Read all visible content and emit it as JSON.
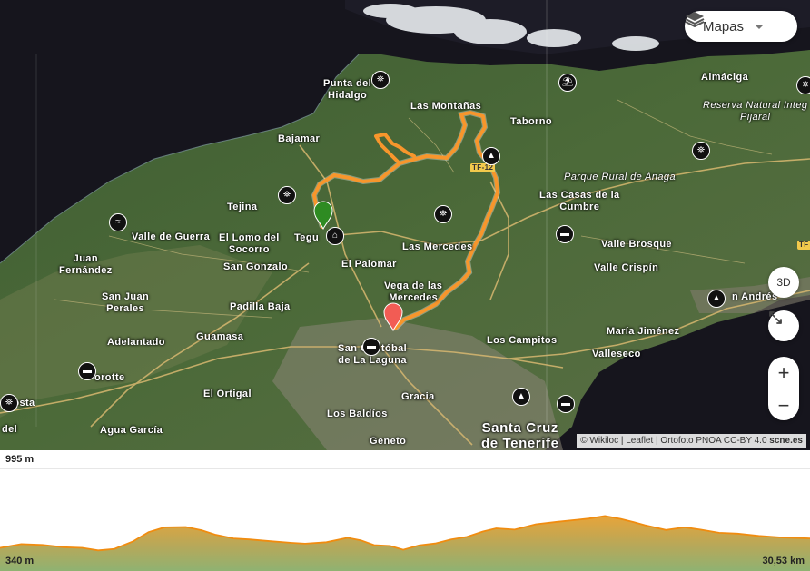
{
  "map": {
    "place_labels": [
      {
        "id": "punta-del-hidalgo",
        "text": "Punta del\nHidalgo"
      },
      {
        "id": "las-montanas",
        "text": "Las Montañas"
      },
      {
        "id": "taborno",
        "text": "Taborno"
      },
      {
        "id": "almaciga",
        "text": "Almáciga"
      },
      {
        "id": "reserva",
        "text": "Reserva Natural Integ\nPijaral"
      },
      {
        "id": "bajamar",
        "text": "Bajamar"
      },
      {
        "id": "parque-rural",
        "text": "Parque Rural de Anaga"
      },
      {
        "id": "las-casas",
        "text": "Las Casas de la\nCumbre"
      },
      {
        "id": "tejina",
        "text": "Tejina"
      },
      {
        "id": "valle-guerra",
        "text": "Valle de Guerra"
      },
      {
        "id": "lomo-socorro",
        "text": "El Lomo del\nSocorro"
      },
      {
        "id": "tegueste",
        "text": "Tegu"
      },
      {
        "id": "las-mercedes",
        "text": "Las Mercedes"
      },
      {
        "id": "valle-brosque",
        "text": "Valle Brosque"
      },
      {
        "id": "juan-fernandez",
        "text": "Juan\nFernández"
      },
      {
        "id": "san-gonzalo",
        "text": "San Gonzalo"
      },
      {
        "id": "el-palomar",
        "text": "El Palomar"
      },
      {
        "id": "valle-crispin",
        "text": "Valle Crispín"
      },
      {
        "id": "vega-mercedes",
        "text": "Vega de las\nMercedes"
      },
      {
        "id": "san-juan-perales",
        "text": "San Juan\nPerales"
      },
      {
        "id": "padilla-baja",
        "text": "Padilla Baja"
      },
      {
        "id": "san-andres",
        "text": "n Andrés"
      },
      {
        "id": "guamasa",
        "text": "Guamasa"
      },
      {
        "id": "maria-jimenez",
        "text": "María Jiménez"
      },
      {
        "id": "adelantado",
        "text": "Adelantado"
      },
      {
        "id": "san-cristobal",
        "text": "San Cristóbal\nde La Laguna"
      },
      {
        "id": "los-campitos",
        "text": "Los Campitos"
      },
      {
        "id": "valleseco",
        "text": "Valleseco"
      },
      {
        "id": "orotte",
        "text": "orotte"
      },
      {
        "id": "costa",
        "text": "Costa"
      },
      {
        "id": "el-ortigal",
        "text": "El Ortigal"
      },
      {
        "id": "gracia",
        "text": "Gracia"
      },
      {
        "id": "del",
        "text": "del"
      },
      {
        "id": "los-baldios",
        "text": "Los Baldíos"
      },
      {
        "id": "agua-garcia",
        "text": "Agua García"
      },
      {
        "id": "geneto",
        "text": "Geneto"
      },
      {
        "id": "santa-cruz",
        "text": "Santa Cruz\nde Tenerife"
      }
    ],
    "road_labels": [
      "TF-12",
      "TF"
    ],
    "poi_icons": [
      {
        "id": "poi-1",
        "icon": "binoculars-icon",
        "glyph": "⛯"
      },
      {
        "id": "poi-2",
        "icon": "beach-icon",
        "glyph": "⛱"
      },
      {
        "id": "poi-3",
        "icon": "binoculars-icon",
        "glyph": "⛯"
      },
      {
        "id": "poi-4",
        "icon": "mountain-icon",
        "glyph": "▲"
      },
      {
        "id": "poi-5",
        "icon": "binoculars-icon",
        "glyph": "⛯"
      },
      {
        "id": "poi-6",
        "icon": "binoculars-icon",
        "glyph": "⛯"
      },
      {
        "id": "poi-7",
        "icon": "swimming-icon",
        "glyph": "≈"
      },
      {
        "id": "poi-8",
        "icon": "binoculars-icon",
        "glyph": "⛯"
      },
      {
        "id": "poi-9",
        "icon": "museum-icon",
        "glyph": "⌂"
      },
      {
        "id": "poi-10",
        "icon": "bed-icon",
        "glyph": "▬"
      },
      {
        "id": "poi-11",
        "icon": "tent-icon",
        "glyph": "▲"
      },
      {
        "id": "poi-12",
        "icon": "bed-icon",
        "glyph": "▬"
      },
      {
        "id": "poi-13",
        "icon": "bed-icon",
        "glyph": "▬"
      },
      {
        "id": "poi-14",
        "icon": "binoculars-icon",
        "glyph": "⛯"
      },
      {
        "id": "poi-15",
        "icon": "tent-icon",
        "glyph": "▲"
      },
      {
        "id": "poi-16",
        "icon": "car-icon",
        "glyph": "▬"
      },
      {
        "id": "poi-17",
        "icon": "binoculars-icon",
        "glyph": "⛯"
      }
    ],
    "controls": {
      "layer_button_label": "Mapas",
      "button_3d_label": "3D",
      "zoom_in_label": "+",
      "zoom_out_label": "−"
    },
    "attribution": {
      "prefix": "© Wikiloc | Leaflet | Ortofoto PNOA CC-BY 4.0",
      "bold": "scne.es"
    },
    "colors": {
      "track": "#f7962c",
      "start_marker": "#2e8b22",
      "end_marker": "#f25c54"
    }
  },
  "elevation_profile": {
    "max_label": "995 m",
    "min_label": "340 m",
    "distance_label": "30,53 km",
    "min_m": 340,
    "max_m": 995,
    "distance_km": 30.53,
    "profile_points": [
      [
        0,
        365
      ],
      [
        0.8,
        395
      ],
      [
        1.6,
        388
      ],
      [
        2.4,
        370
      ],
      [
        3.1,
        365
      ],
      [
        3.7,
        345
      ],
      [
        4.3,
        356
      ],
      [
        5.0,
        415
      ],
      [
        5.6,
        490
      ],
      [
        6.2,
        528
      ],
      [
        7.0,
        531
      ],
      [
        7.6,
        505
      ],
      [
        8.1,
        470
      ],
      [
        8.8,
        440
      ],
      [
        9.4,
        432
      ],
      [
        10.2,
        418
      ],
      [
        11.0,
        405
      ],
      [
        11.5,
        398
      ],
      [
        12.3,
        410
      ],
      [
        13.1,
        445
      ],
      [
        13.6,
        425
      ],
      [
        14.1,
        387
      ],
      [
        14.7,
        380
      ],
      [
        15.2,
        350
      ],
      [
        15.8,
        385
      ],
      [
        16.4,
        400
      ],
      [
        17.0,
        432
      ],
      [
        17.6,
        452
      ],
      [
        18.2,
        495
      ],
      [
        18.7,
        520
      ],
      [
        19.4,
        510
      ],
      [
        20.2,
        552
      ],
      [
        21.0,
        572
      ],
      [
        22.2,
        598
      ],
      [
        22.8,
        618
      ],
      [
        23.4,
        595
      ],
      [
        23.9,
        568
      ],
      [
        24.3,
        545
      ],
      [
        25.1,
        507
      ],
      [
        25.8,
        528
      ],
      [
        26.4,
        510
      ],
      [
        27.1,
        485
      ],
      [
        27.8,
        478
      ],
      [
        28.6,
        460
      ],
      [
        29.5,
        447
      ],
      [
        30.53,
        440
      ]
    ]
  }
}
